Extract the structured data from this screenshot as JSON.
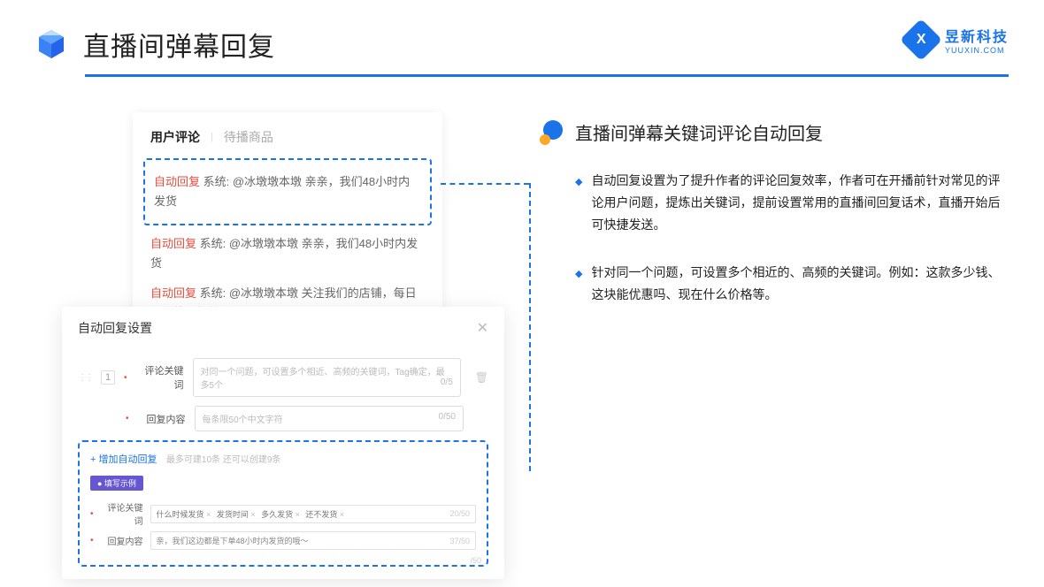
{
  "header": {
    "title": "直播间弹幕回复"
  },
  "brand": {
    "cn": "昱新科技",
    "en": "YUUXIN.COM"
  },
  "comments": {
    "tabs": {
      "active": "用户评论",
      "inactive": "待播商品"
    },
    "items": [
      {
        "badge": "自动回复",
        "text": "系统: @冰墩墩本墩 亲亲，我们48小时内发货"
      },
      {
        "badge": "自动回复",
        "text": "系统: @冰墩墩本墩 亲亲，我们48小时内发货"
      },
      {
        "badge": "自动回复",
        "text": "系统: @冰墩墩本墩 关注我们的店铺，每日都有热门推荐哟～"
      }
    ]
  },
  "settings": {
    "title": "自动回复设置",
    "order": "1",
    "row1": {
      "label": "评论关键词",
      "placeholder": "对同一个问题，可设置多个相近、高频的关键词，Tag确定，最多5个",
      "counter": "0/5"
    },
    "row2": {
      "label": "回复内容",
      "placeholder": "每条限50个中文字符",
      "counter": "0/50"
    },
    "example": {
      "addLink": "+ 增加自动回复",
      "addHint": "最多可建10条 还可以创建9条",
      "tag": "● 填写示例",
      "row1": {
        "label": "评论关键词",
        "chips": [
          "什么时候发货",
          "发货时间",
          "多久发货",
          "还不发货"
        ],
        "counter": "20/50"
      },
      "row2": {
        "label": "回复内容",
        "text": "亲，我们这边都是下单48小时内发货的哦～",
        "counter": "37/50"
      },
      "overflowCounter": "/50"
    }
  },
  "feature": {
    "title": "直播间弹幕关键词评论自动回复",
    "bullets": [
      "自动回复设置为了提升作者的评论回复效率，作者可在开播前针对常见的评论用户问题，提炼出关键词，提前设置常用的直播间回复话术，直播开始后可快捷发送。",
      "针对同一个问题，可设置多个相近的、高频的关键词。例如：这款多少钱、这块能优惠吗、现在什么价格等。"
    ]
  }
}
